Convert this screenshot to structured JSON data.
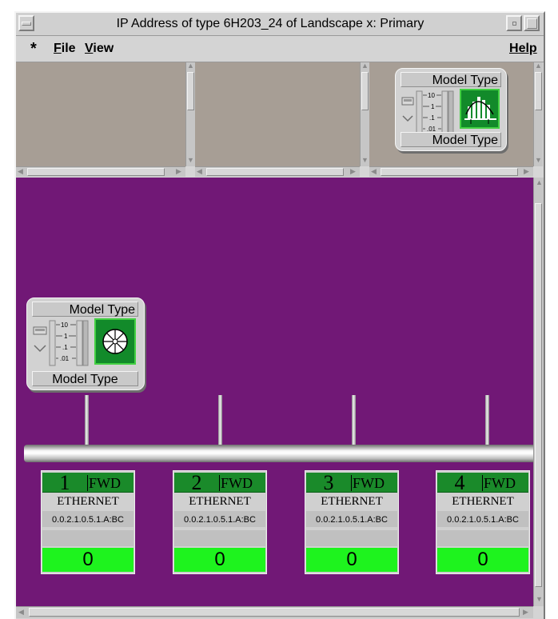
{
  "window": {
    "title": "IP Address of type 6H203_24 of Landscape x: Primary"
  },
  "menubar": {
    "star": "*",
    "file": {
      "first": "F",
      "rest": "ile"
    },
    "view": {
      "first": "V",
      "rest": "iew"
    },
    "help": {
      "first": "H",
      "rest": "elp"
    }
  },
  "top_model": {
    "top_label": "Model Type",
    "bottom_label": "Model Type",
    "scale": [
      "10",
      "1",
      ".1",
      ".01"
    ],
    "icon": "bar-chart-icon"
  },
  "main_model": {
    "top_label": "Model Type",
    "bottom_label": "Model Type",
    "scale": [
      "10",
      "1",
      ".1",
      ".01"
    ],
    "icon": "wheel-icon"
  },
  "ports": [
    {
      "number": "1",
      "status": "FWD",
      "type": "ETHERNET",
      "address": "0.0.2.1.0.5.1.A:BC",
      "count": "0"
    },
    {
      "number": "2",
      "status": "FWD",
      "type": "ETHERNET",
      "address": "0.0.2.1.0.5.1.A:BC",
      "count": "0"
    },
    {
      "number": "3",
      "status": "FWD",
      "type": "ETHERNET",
      "address": "0.0.2.1.0.5.1.A:BC",
      "count": "0"
    },
    {
      "number": "4",
      "status": "FWD",
      "type": "ETHERNET",
      "address": "0.0.2.1.0.5.1.A:BC",
      "count": "0"
    }
  ],
  "colors": {
    "canvas": "#711876",
    "status_green": "#1a8a2a",
    "counter_green": "#1ef31e",
    "pane": "#a79e95"
  }
}
